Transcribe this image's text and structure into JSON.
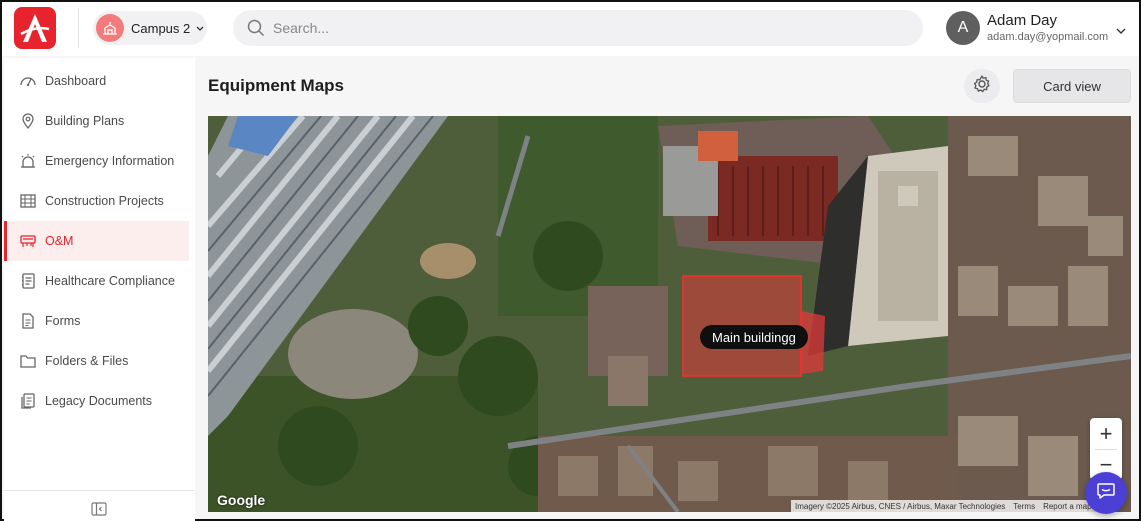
{
  "app": {
    "logo_icon": "asset-logo-icon",
    "brand_color": "#e7232d"
  },
  "campus": {
    "label": "Campus 2",
    "icon": "campus-building-icon"
  },
  "search": {
    "placeholder": "Search..."
  },
  "user": {
    "initial": "A",
    "name": "Adam Day",
    "email": "adam.day@yopmail.com"
  },
  "sidebar": {
    "items": [
      {
        "label": "Dashboard",
        "icon": "dashboard-icon",
        "active": false
      },
      {
        "label": "Building Plans",
        "icon": "map-pin-icon",
        "active": false
      },
      {
        "label": "Emergency Information",
        "icon": "alarm-icon",
        "active": false
      },
      {
        "label": "Construction Projects",
        "icon": "construction-icon",
        "active": false
      },
      {
        "label": "O&M",
        "icon": "om-icon",
        "active": true
      },
      {
        "label": "Healthcare Compliance",
        "icon": "compliance-icon",
        "active": false
      },
      {
        "label": "Forms",
        "icon": "form-icon",
        "active": false
      },
      {
        "label": "Folders & Files",
        "icon": "folder-icon",
        "active": false
      },
      {
        "label": "Legacy Documents",
        "icon": "documents-icon",
        "active": false
      }
    ]
  },
  "main": {
    "title": "Equipment Maps",
    "card_view_label": "Card view"
  },
  "map": {
    "marker_label": "Main buildingg",
    "google_logo": "Google",
    "attribution": {
      "imagery": "Imagery ©2025 Airbus, CNES / Airbus, Maxar Technologies",
      "terms": "Terms",
      "report": "Report a map error"
    },
    "zoom_in": "+",
    "zoom_out": "−"
  }
}
